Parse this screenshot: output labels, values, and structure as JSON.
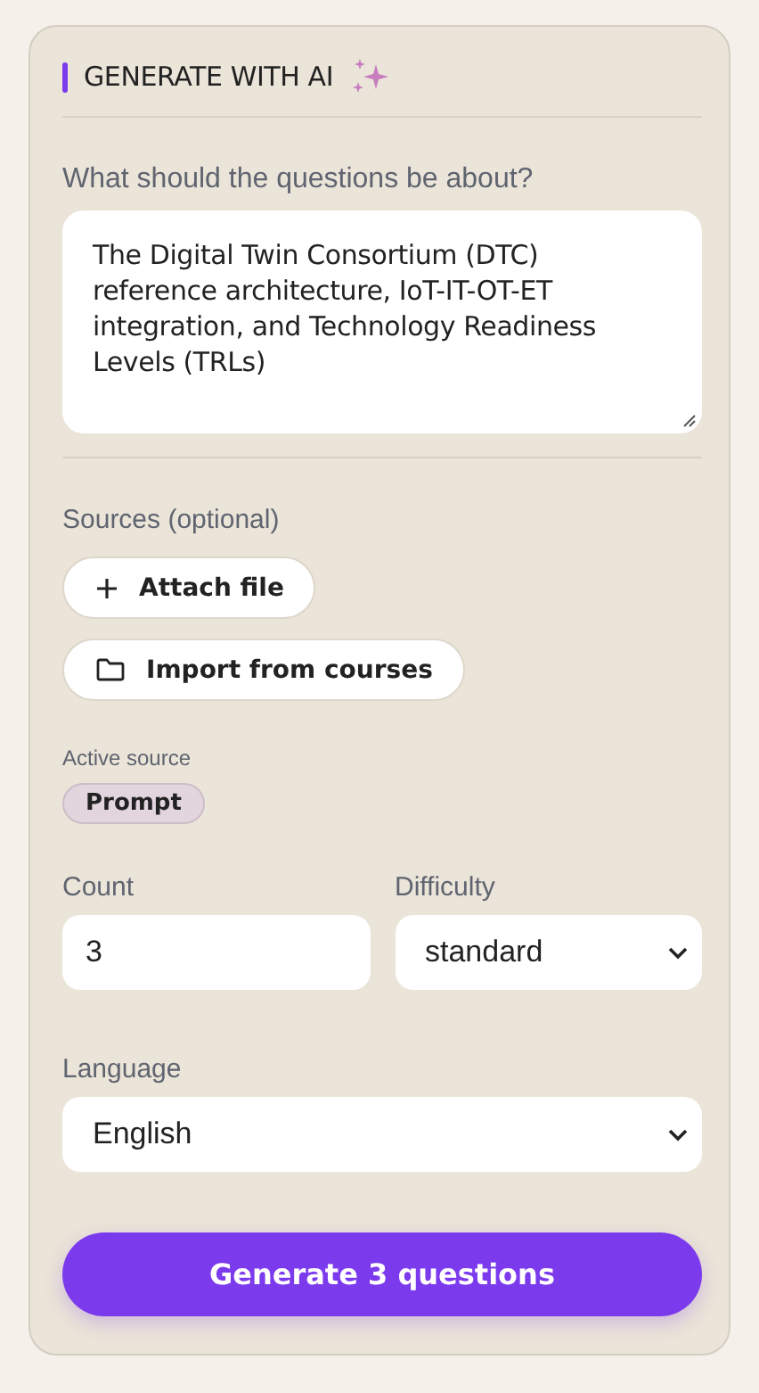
{
  "panel": {
    "title": "GENERATE WITH AI"
  },
  "topic": {
    "label": "What should the questions be about?",
    "value": "The Digital Twin Consortium (DTC) reference architecture, IoT-IT-OT-ET integration, and Technology Readiness Levels (TRLs)"
  },
  "sources": {
    "label": "Sources (optional)",
    "buttons": [
      {
        "kind": "attach",
        "label": "Attach file"
      },
      {
        "kind": "import",
        "label": "Import from courses"
      }
    ],
    "active_label": "Active source",
    "active_chips": [
      "Prompt"
    ]
  },
  "count": {
    "label": "Count",
    "value": "3"
  },
  "difficulty": {
    "label": "Difficulty",
    "value": "standard"
  },
  "language": {
    "label": "Language",
    "value": "English"
  },
  "generate_button": "Generate 3 questions"
}
